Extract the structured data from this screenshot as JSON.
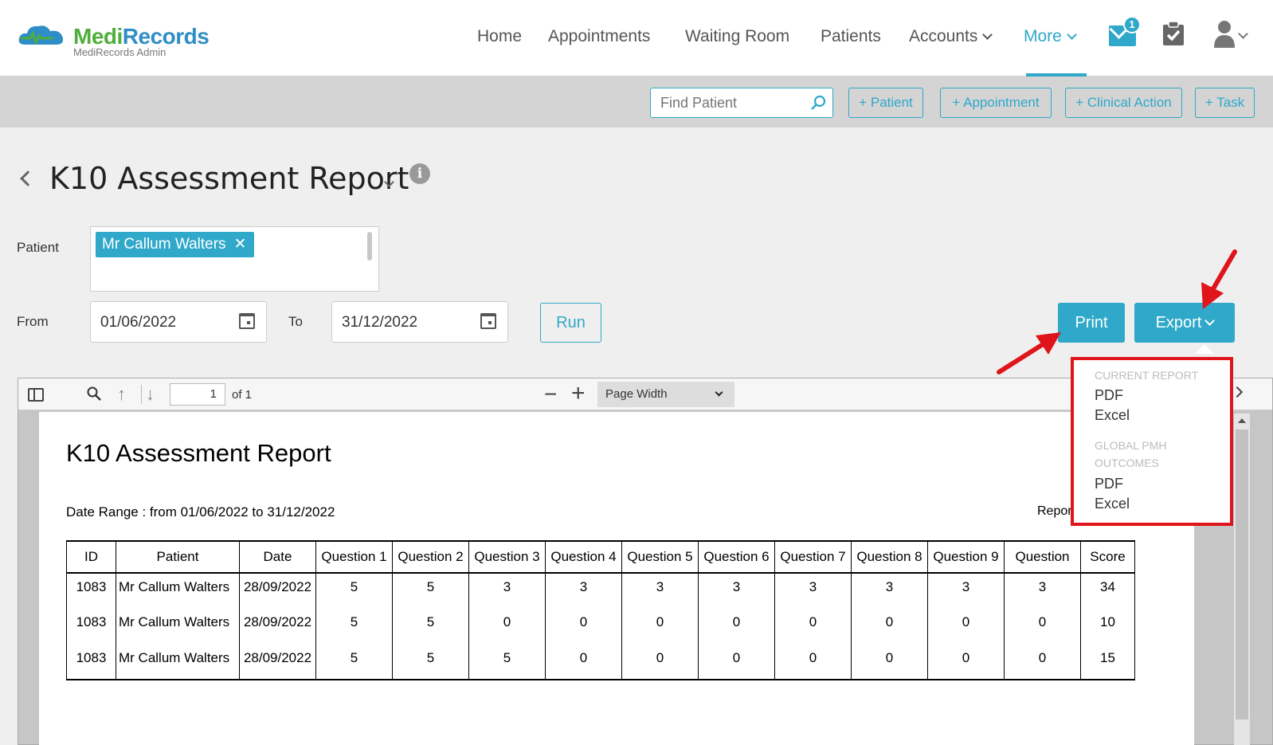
{
  "brand": {
    "name_part1": "Medi",
    "name_part2": "Records",
    "subtitle": "MediRecords Admin"
  },
  "nav": {
    "items": [
      {
        "label": "Home"
      },
      {
        "label": "Appointments"
      },
      {
        "label": "Waiting Room"
      },
      {
        "label": "Patients"
      },
      {
        "label": "Accounts"
      },
      {
        "label": "More"
      }
    ],
    "mail_badge": "1"
  },
  "toolbar": {
    "search_placeholder": "Find Patient",
    "buttons": [
      "+ Patient",
      "+ Appointment",
      "+ Clinical Action",
      "+ Task"
    ]
  },
  "page": {
    "title": "K10 Assessment Report"
  },
  "form": {
    "patient_label": "Patient",
    "patient_tag": "Mr Callum Walters",
    "from_label": "From",
    "from_value": "01/06/2022",
    "to_label": "To",
    "to_value": "31/12/2022",
    "run_label": "Run",
    "print_label": "Print",
    "export_label": "Export"
  },
  "viewer": {
    "page_number": "1",
    "page_of": "of 1",
    "zoom": "Page Width"
  },
  "report": {
    "title": "K10 Assessment Report",
    "date_range": "Date Range : from 01/06/2022 to 31/12/2022",
    "version_text": "Report Ve",
    "columns": [
      "ID",
      "Patient",
      "Date",
      "Question 1",
      "Question 2",
      "Question 3",
      "Question 4",
      "Question 5",
      "Question 6",
      "Question 7",
      "Question 8",
      "Question 9",
      "Question",
      "Score"
    ],
    "rows": [
      [
        "1083",
        "Mr Callum Walters",
        "28/09/2022",
        "5",
        "5",
        "3",
        "3",
        "3",
        "3",
        "3",
        "3",
        "3",
        "3",
        "34"
      ],
      [
        "1083",
        "Mr Callum Walters",
        "28/09/2022",
        "5",
        "5",
        "0",
        "0",
        "0",
        "0",
        "0",
        "0",
        "0",
        "0",
        "10"
      ],
      [
        "1083",
        "Mr Callum Walters",
        "28/09/2022",
        "5",
        "5",
        "5",
        "0",
        "0",
        "0",
        "0",
        "0",
        "0",
        "0",
        "15"
      ]
    ]
  },
  "export_menu": {
    "section1": "CURRENT REPORT",
    "section1_items": [
      "PDF",
      "Excel"
    ],
    "section2_line1": "GLOBAL PMH",
    "section2_line2": "OUTCOMES",
    "section2_items": [
      "PDF",
      "Excel"
    ]
  },
  "colors": {
    "accent": "#2fa8c9",
    "highlight": "#e0141b",
    "brand_green": "#4fae3c"
  }
}
